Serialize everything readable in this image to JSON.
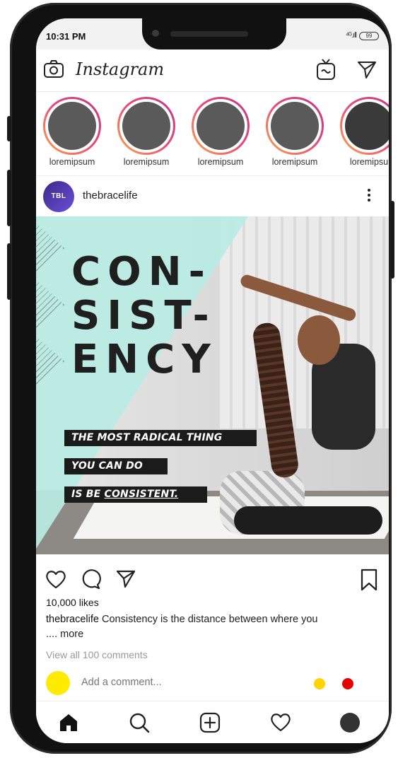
{
  "status_bar": {
    "time": "10:31 PM",
    "signal": "⁴ᴳ.ıll",
    "battery": "99"
  },
  "app": {
    "name": "Instagram"
  },
  "stories": [
    {
      "label": "loremipsum"
    },
    {
      "label": "loremipsum"
    },
    {
      "label": "loremipsum"
    },
    {
      "label": "loremipsum"
    },
    {
      "label": "loremipsu"
    }
  ],
  "post": {
    "avatar_text": "TBL",
    "username": "thebracelife",
    "headline": [
      "CON-",
      "SIST-",
      "ENCY"
    ],
    "quote_lines": [
      "THE MOST RADICAL THING",
      "YOU CAN DO",
      "IS BE "
    ],
    "quote_emphasis": "CONSISTENT.",
    "likes": "10,000 likes",
    "caption_user": "thebracelife",
    "caption_text": " Consistency is the distance between where you",
    "caption_more": ".... more",
    "view_comments": "View all 100 comments",
    "add_comment_placeholder": "Add a comment..."
  },
  "colors": {
    "story_ring": "#e94b7a",
    "mint": "#b9ebe3",
    "me_avatar": "#ffeb00",
    "reaction_yellow": "#ffd400",
    "reaction_red": "#e60000"
  },
  "icons": {
    "topbar": [
      "camera-icon",
      "igtv-icon",
      "send-icon"
    ],
    "actions": [
      "heart-icon",
      "comment-icon",
      "share-icon",
      "bookmark-icon"
    ],
    "bottom_nav": [
      "home-icon",
      "search-icon",
      "add-post-icon",
      "activity-heart-icon",
      "profile-icon"
    ]
  }
}
